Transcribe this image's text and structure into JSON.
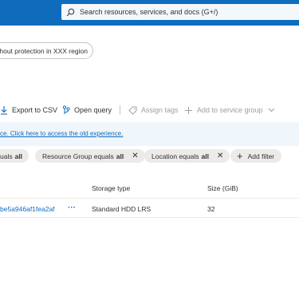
{
  "header": {
    "search_placeholder": "Search resources, services, and docs (G+/)"
  },
  "recommendation_pill": "thout protection in XXX region",
  "toolbar": {
    "export_label": "Export to CSV",
    "open_query_label": "Open query",
    "assign_tags_label": "Assign tags",
    "add_service_group_label": "Add to service group"
  },
  "banner": {
    "link_text": "ce. Click here to access the old experience."
  },
  "filters": [
    {
      "label": "uals",
      "value": "all"
    },
    {
      "label": "Resource Group equals",
      "value": "all"
    },
    {
      "label": "Location equals",
      "value": "all"
    }
  ],
  "add_filter_label": "Add filter",
  "table": {
    "columns": [
      "Storage type",
      "Size (GiB)"
    ],
    "rows": [
      {
        "name": "be5a946af1fea2af",
        "more": "···",
        "storage_type": "Standard HDD LRS",
        "size": "32"
      }
    ]
  }
}
